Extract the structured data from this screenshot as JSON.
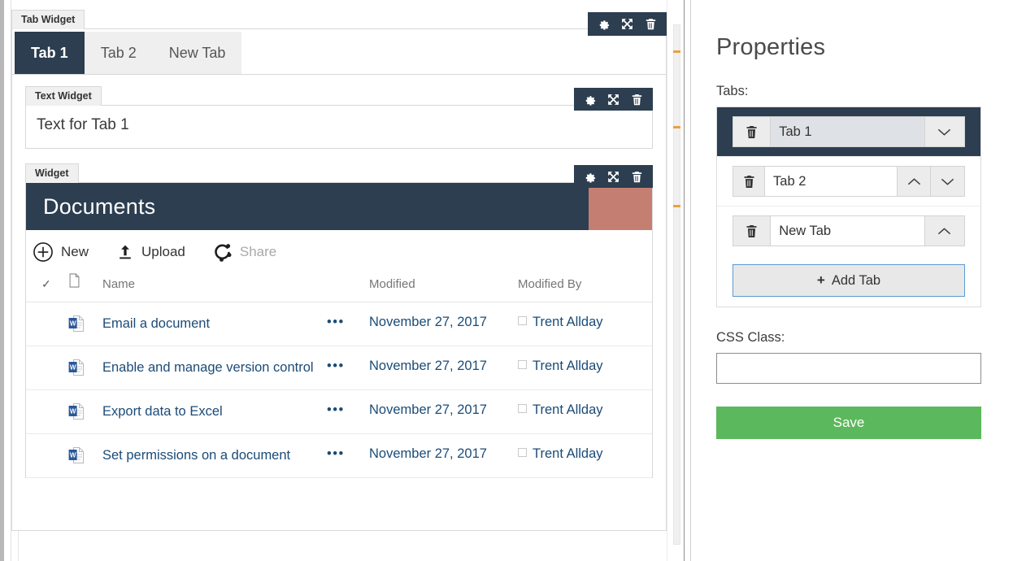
{
  "widgets": {
    "tab_widget": {
      "label": "Tab Widget",
      "tools": {
        "settings": "gear-icon",
        "move": "move-icon",
        "delete": "trash-icon"
      },
      "tabs": [
        {
          "label": "Tab 1",
          "active": true
        },
        {
          "label": "Tab 2",
          "active": false
        },
        {
          "label": "New Tab",
          "active": false
        }
      ]
    },
    "text_widget": {
      "label": "Text Widget",
      "text": "Text for Tab 1"
    },
    "documents_widget": {
      "label": "Widget",
      "title": "Documents",
      "actions": [
        {
          "label": "New",
          "icon": "plus-circle-icon",
          "disabled": false
        },
        {
          "label": "Upload",
          "icon": "upload-icon",
          "disabled": false
        },
        {
          "label": "Share",
          "icon": "share-icon",
          "disabled": true
        }
      ],
      "columns": {
        "check": "✓",
        "icon": "document-icon",
        "name": "Name",
        "modified": "Modified",
        "modified_by": "Modified By"
      },
      "rows": [
        {
          "name": "Email a document",
          "ellipsis": "•••",
          "modified": "November 27, 2017",
          "modified_by": "Trent Allday",
          "file_type": "word"
        },
        {
          "name": "Enable and manage version control",
          "ellipsis": "•••",
          "modified": "November 27, 2017",
          "modified_by": "Trent Allday",
          "file_type": "word"
        },
        {
          "name": "Export data to Excel",
          "ellipsis": "•••",
          "modified": "November 27, 2017",
          "modified_by": "Trent Allday",
          "file_type": "word"
        },
        {
          "name": "Set permissions on a document",
          "ellipsis": "•••",
          "modified": "November 27, 2017",
          "modified_by": "Trent Allday",
          "file_type": "word"
        }
      ]
    }
  },
  "properties": {
    "title": "Properties",
    "tabs_label": "Tabs:",
    "tab_rows": [
      {
        "name": "Tab 1",
        "selected": true,
        "has_up": false,
        "has_down": true
      },
      {
        "name": "Tab 2",
        "selected": false,
        "has_up": true,
        "has_down": true
      },
      {
        "name": "New Tab",
        "selected": false,
        "has_up": true,
        "has_down": false
      }
    ],
    "add_tab_label": "Add Tab",
    "add_tab_plus": "+",
    "css_class_label": "CSS Class:",
    "css_class_value": "",
    "css_class_placeholder": "",
    "save_label": "Save"
  },
  "colors": {
    "navy": "#2c3e50",
    "rose": "#c47f72",
    "green": "#5cb85c",
    "link_blue": "#13457a",
    "focus_blue": "#5b9bd5"
  }
}
